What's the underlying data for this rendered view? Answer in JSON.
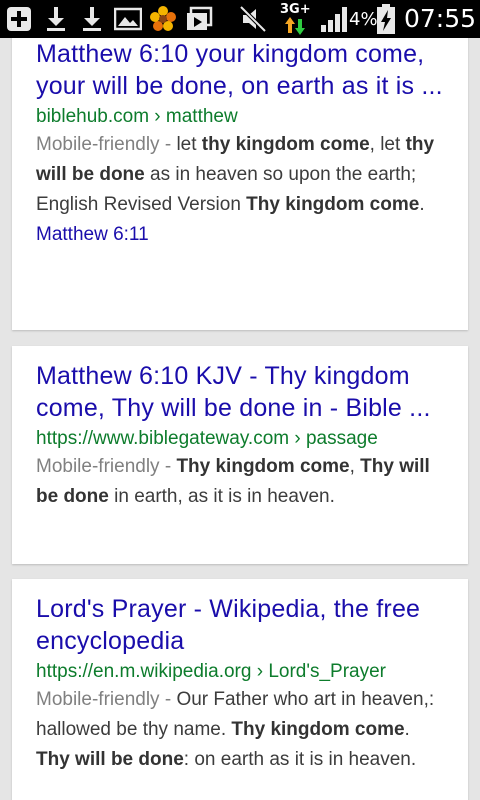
{
  "status_bar": {
    "icons": [
      "add-icon",
      "download-icon",
      "download-icon",
      "image-icon",
      "flower-icon",
      "photos-icon",
      "mute-icon",
      "data-arrows-icon",
      "signal-icon",
      "battery-charging-icon"
    ],
    "network": "3G+",
    "battery": "4%",
    "time": "07:55",
    "colors": {
      "background": "#000000",
      "data_up": "#f5a623",
      "data_down": "#2ecc40"
    }
  },
  "results": [
    {
      "title": "Matthew 6:10 your kingdom come, your will be done, on earth as it is ...",
      "url": "biblehub.com › matthew",
      "mf": "Mobile-friendly - ",
      "snippet": [
        {
          "t": "let ",
          "b": false
        },
        {
          "t": "thy kingdom come",
          "b": true
        },
        {
          "t": ", let ",
          "b": false
        },
        {
          "t": "thy will be done",
          "b": true
        },
        {
          "t": " as in heaven so upon the earth; English Revised Version ",
          "b": false
        },
        {
          "t": "Thy kingdom come",
          "b": true
        },
        {
          "t": ".",
          "b": false
        }
      ],
      "sublink": "Matthew 6:11"
    },
    {
      "title": "Matthew 6:10 KJV - Thy kingdom come, Thy will be done in - Bible ...",
      "url": "https://www.biblegateway.com › passage",
      "mf": "Mobile-friendly - ",
      "snippet": [
        {
          "t": "Thy kingdom come",
          "b": true
        },
        {
          "t": ", ",
          "b": false
        },
        {
          "t": "Thy will be done",
          "b": true
        },
        {
          "t": " in earth, as it is in heaven.",
          "b": false
        }
      ]
    },
    {
      "title": "Lord's Prayer - Wikipedia, the free encyclopedia",
      "url": "https://en.m.wikipedia.org › Lord's_Prayer",
      "mf": "Mobile-friendly - ",
      "snippet": [
        {
          "t": "Our Father who art in heaven,: hallowed be thy name. ",
          "b": false
        },
        {
          "t": "Thy kingdom come",
          "b": true
        },
        {
          "t": ". ",
          "b": false
        },
        {
          "t": "Thy will be done",
          "b": true
        },
        {
          "t": ": on earth as it is in heaven.",
          "b": false
        }
      ]
    }
  ],
  "colors": {
    "title": "#1a0dab",
    "url": "#0d7c2c",
    "snippet": "#3c3c3c",
    "mobile_friendly": "#808080",
    "page_bg": "#e5e5e5"
  }
}
